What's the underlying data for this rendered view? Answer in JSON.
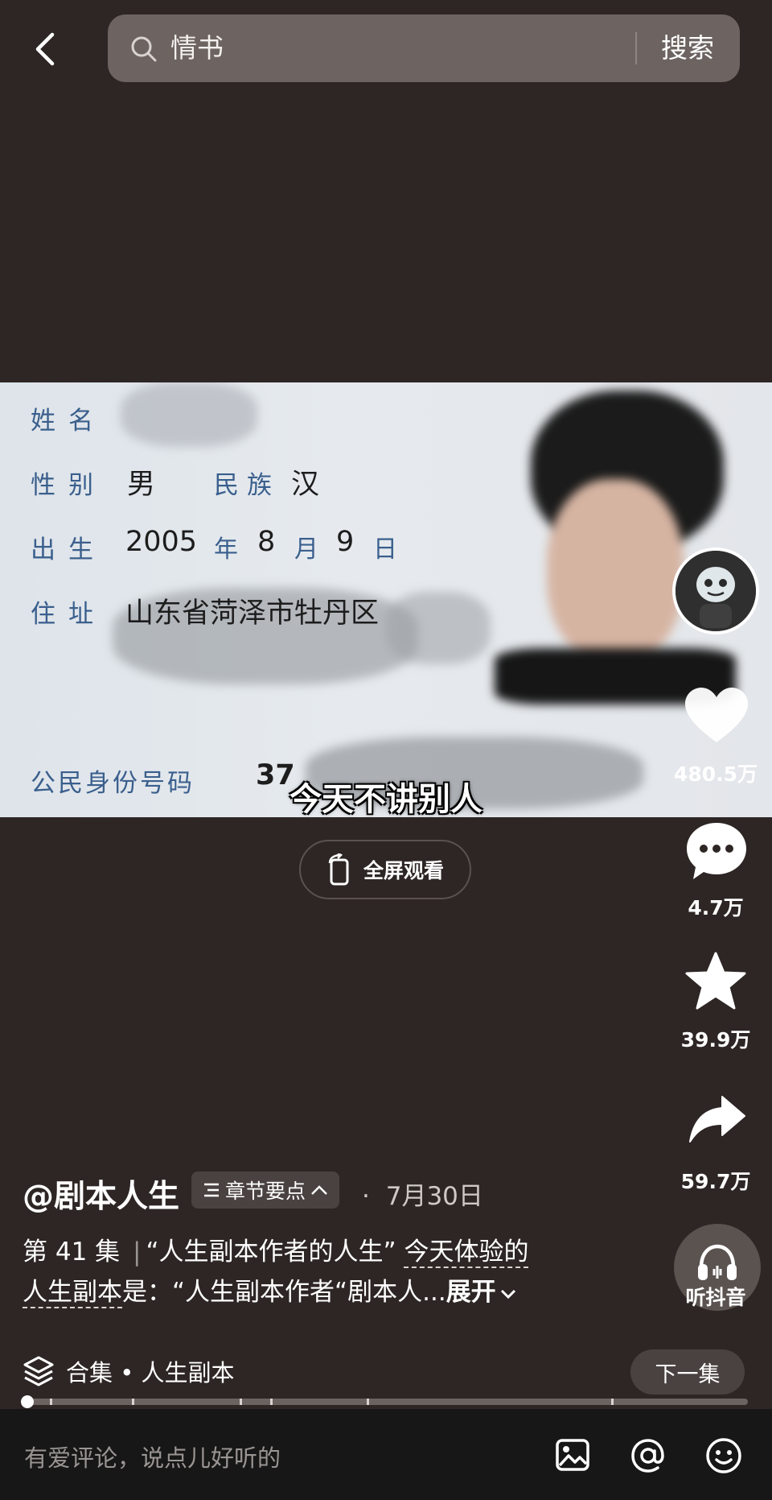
{
  "top_bar": {
    "search_query": "情书",
    "search_button": "搜索"
  },
  "video": {
    "card": {
      "label_name": "姓名",
      "label_gender": "性别",
      "gender": "男",
      "label_ethnicity": "民族",
      "ethnicity": "汉",
      "label_birth": "出生",
      "birth_year": "2005",
      "birth_year_unit": "年",
      "birth_month": "8",
      "birth_month_unit": "月",
      "birth_day": "9",
      "birth_day_unit": "日",
      "label_address": "住址",
      "address": "山东省菏泽市牡丹区",
      "label_id": "公民身份号码",
      "id_partial": "37"
    },
    "subtitle": "今天不讲别人",
    "fullscreen_label": "全屏观看"
  },
  "rail": {
    "likes": "480.5万",
    "comments": "4.7万",
    "favorites": "39.9万",
    "shares": "59.7万",
    "listen_label": "听抖音"
  },
  "info": {
    "author": "@剧本人生",
    "chapter_chip": "章节要点",
    "date_separator": "·",
    "date": "7月30日",
    "desc_prefix": "第 41 集",
    "desc_sep": "|",
    "desc_quote": "“人生副本作者的人生”",
    "desc_link": "今天体验的",
    "desc_link2": "人生副本",
    "desc_rest": "是：“人生副本作者“剧本人...",
    "expand": "展开"
  },
  "collection": {
    "label": "合集 • 人生副本",
    "next": "下一集"
  },
  "progress": {
    "value": 0.0
  },
  "comment": {
    "placeholder": "有爱评论，说点儿好听的"
  },
  "icons": {
    "back": "chevron-left-icon",
    "search": "search-icon",
    "heart": "heart-icon",
    "comment": "comment-icon",
    "star": "star-icon",
    "share": "share-icon",
    "headphones": "headphones-icon",
    "layers": "layers-icon",
    "image": "image-icon",
    "at": "at-icon",
    "emoji": "emoji-icon"
  }
}
